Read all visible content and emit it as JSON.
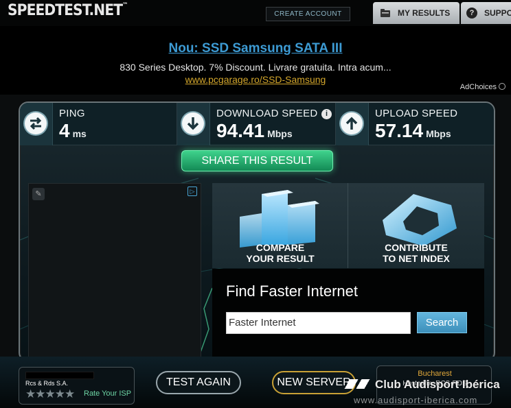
{
  "header": {
    "logo": "SPEEDTEST.NET",
    "logo_tm": "™",
    "create_account": "CREATE ACCOUNT",
    "tabs": [
      {
        "label": "MY RESULTS",
        "icon": "folder-icon"
      },
      {
        "label": "SUPPO",
        "icon": "help-icon"
      }
    ]
  },
  "ad": {
    "title": "Nou: SSD Samsung SATA III",
    "description": "830 Series Desktop. 7% Discount. Livrare gratuita. Intra acum...",
    "url": "www.pcgarage.ro/SSD-Samsung",
    "adchoices": "AdChoices"
  },
  "stats": {
    "ping": {
      "label": "PING",
      "value": "4",
      "unit": "ms",
      "icon": "swap-arrows-icon"
    },
    "download": {
      "label": "DOWNLOAD SPEED",
      "value": "94.41",
      "unit": "Mbps",
      "icon": "download-arrow-icon"
    },
    "upload": {
      "label": "UPLOAD SPEED",
      "value": "57.14",
      "unit": "Mbps",
      "icon": "upload-arrow-icon"
    }
  },
  "share_button": "SHARE THIS RESULT",
  "cards": {
    "compare": {
      "line1": "COMPARE",
      "line2": "YOUR RESULT"
    },
    "contribute": {
      "line1": "CONTRIBUTE",
      "line2": "TO NET INDEX"
    }
  },
  "find": {
    "title": "Find Faster Internet",
    "input_value": "Faster Internet",
    "search_button": "Search"
  },
  "bottom": {
    "isp_name": "Rcs & Rds S.A.",
    "rate_isp": "Rate Your ISP",
    "stars": "★★★★★",
    "test_again": "TEST AGAIN",
    "new_server": "NEW SERVER",
    "server_city": "Bucharest",
    "server_hosted": "Hosted by RCS-RDS"
  },
  "watermark": {
    "text": "Club Audisport Ibérica",
    "url": "www.audisport-iberica.com"
  },
  "colors": {
    "accent_green": "#2bbf7a",
    "link_blue": "#3d9bd4",
    "url_gold": "#d4a72c",
    "server_orange": "#e2a93a"
  }
}
